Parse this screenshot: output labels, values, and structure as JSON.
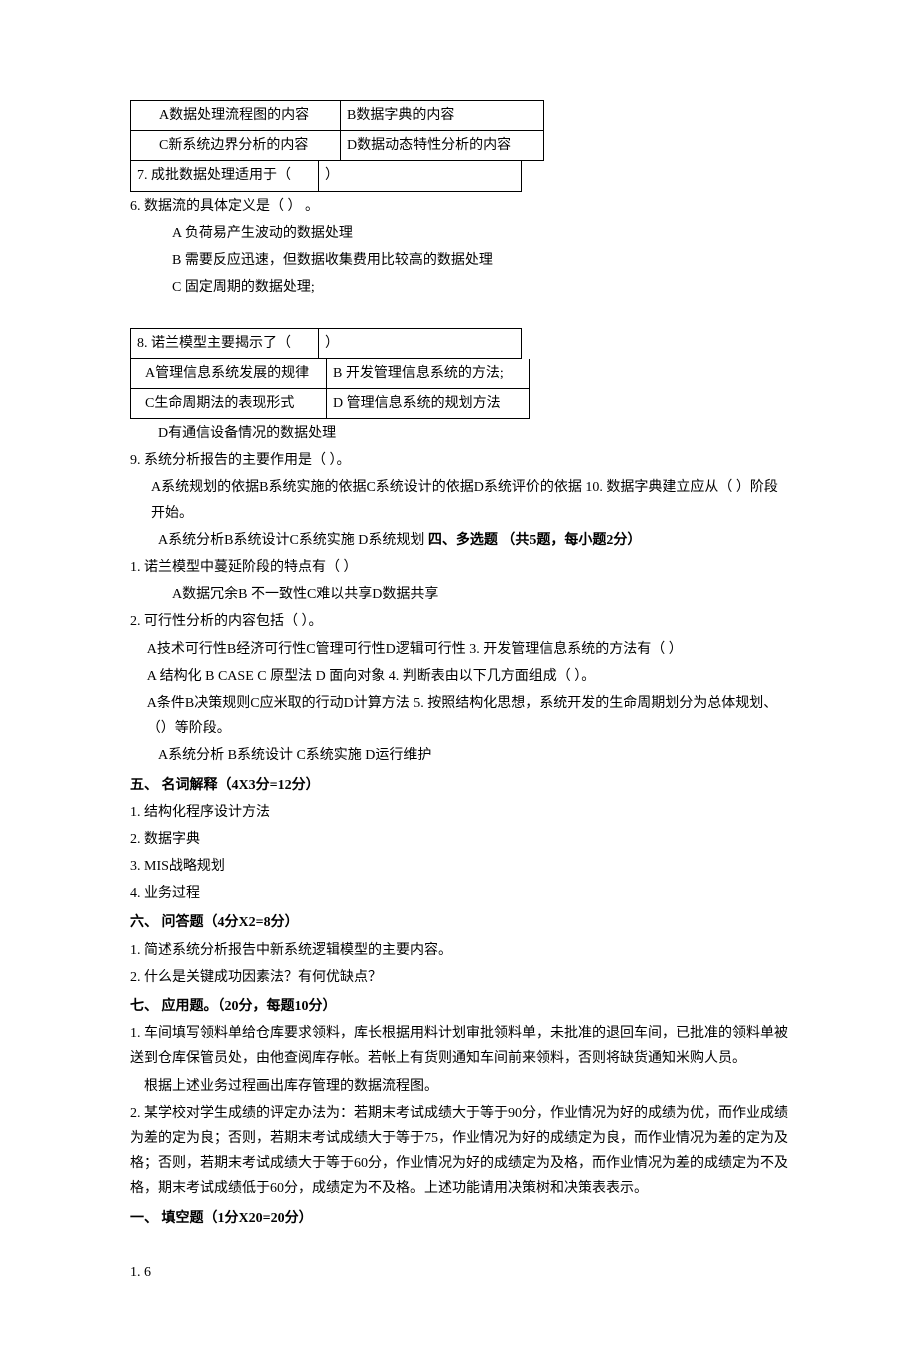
{
  "t1": {
    "r1c1": "A数据处理流程图的内容",
    "r1c2": "B数据字典的内容",
    "r2c1": "C新系统边界分析的内容",
    "r2c2": "D数据动态特性分析的内容",
    "r3c1": "7.  成批数据处理适用于（",
    "r3c2": "）"
  },
  "q6": {
    "title": "6.  数据流的具体定义是（ ） 。",
    "a": "A 负荷易产生波动的数据处理",
    "b": "B 需要反应迅速，但数据收集费用比较高的数据处理",
    "c": "C 固定周期的数据处理;"
  },
  "t2": {
    "r1c1": "8.  诺兰模型主要揭示了（",
    "r1c2": "）",
    "r2c1": "A管理信息系统发展的规律",
    "r2c2": "B 开发管理信息系统的方法;",
    "r3c1": "C生命周期法的表现形式",
    "r3c2": "D 管理信息系统的规划方法"
  },
  "dline": "D有通信设备情况的数据处理",
  "q9": {
    "title": "9.  系统分析报告的主要作用是（ ）。",
    "line": "A系统规划的依据B系统实施的依据C系统设计的依据D系统评价的依据 10.  数据字典建立应从（  ）阶段开始。",
    "opts": "A系统分析B系统设计C系统实施 D系统规划",
    "sec4": "四、多选题 （共5题，每小题2分）"
  },
  "mc": {
    "q1": "1.  诺兰模型中蔓延阶段的特点有（ ）",
    "q1opts": "A数据冗余B 不一致性C难以共享D数据共享",
    "q2": "2.  可行性分析的内容包括（       ）。",
    "q2line": "A技术可行性B经济可行性C管理可行性D逻辑可行性 3.  开发管理信息系统的方法有（ ）",
    "q3line": "A 结构化 B CASE C 原型法 D 面向对象 4.  判断表由以下几方面组成（  ）。",
    "q4line": "A条件B决策规则C应米取的行动D计算方法 5.  按照结构化思想，系统开发的生命周期划分为总体规划、（）等阶段。",
    "q5opts": "A系统分析 B系统设计       C系统实施     D运行维护"
  },
  "sec5": {
    "head": "五、 名词解释（4X3分=12分）",
    "i1": "1.  结构化程序设计方法",
    "i2": "2.  数据字典",
    "i3": "3.  MIS战略规划",
    "i4": "4.  业务过程"
  },
  "sec6": {
    "head": "六、 问答题（4分X2=8分）",
    "i1": "1.  简述系统分析报告中新系统逻辑模型的主要内容。",
    "i2": "2.  什么是关键成功因素法？有何优缺点？"
  },
  "sec7": {
    "head": "七、 应用题。（20分，每题10分）",
    "q1l1": "1.  车间填写领料单给仓库要求领料，库长根据用料计划审批领料单，未批准的退回车间，已批准的领料单被送到仓库保管员处，由他查阅库存帐。若帐上有货则通知车间前来领料，否则将缺货通知米购人员。",
    "q1l2": "根据上述业务过程画出库存管理的数据流程图。",
    "q2": "2.  某学校对学生成绩的评定办法为：若期末考试成绩大于等于90分，作业情况为好的成绩为优，而作业成绩为差的定为良；否则，若期末考试成绩大于等于75，作业情况为好的成绩定为良，而作业情况为差的定为及格；否则，若期末考试成绩大于等于60分，作业情况为好的成绩定为及格，而作业情况为差的成绩定为不及格，期末考试成绩低于60分，成绩定为不及格。上述功能请用决策树和决策表表示。"
  },
  "ans": {
    "head": "一、 填空题（1分X20=20分）",
    "i1": "1.  6"
  }
}
